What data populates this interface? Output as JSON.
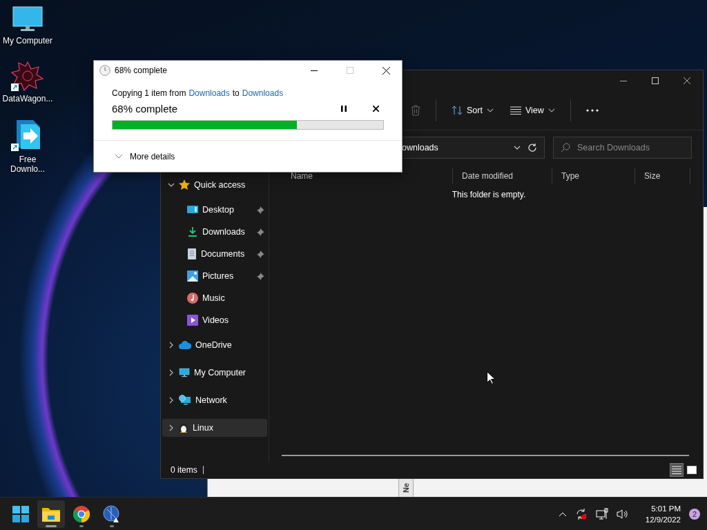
{
  "desktop_icons": [
    {
      "label": "My Computer"
    },
    {
      "label": "DataWagon..."
    },
    {
      "label": "Free Downlo..."
    }
  ],
  "background_window": {
    "tab_label": "Ne"
  },
  "explorer": {
    "toolbar": [
      {
        "label": "Sort"
      },
      {
        "label": "View"
      }
    ],
    "address": "ownloads",
    "search": {
      "placeholder": "Search Downloads"
    },
    "columns": [
      "Name",
      "Date modified",
      "Type",
      "Size"
    ],
    "empty_message": "This folder is empty.",
    "sidebar": [
      {
        "label": "Quick access",
        "expanded": true,
        "selected": false,
        "children": [
          {
            "label": "Desktop",
            "pinned": true,
            "selected": false
          },
          {
            "label": "Downloads",
            "pinned": true,
            "selected": false
          },
          {
            "label": "Documents",
            "pinned": true,
            "selected": false
          },
          {
            "label": "Pictures",
            "pinned": true,
            "selected": false
          },
          {
            "label": "Music",
            "pinned": false,
            "selected": false
          },
          {
            "label": "Videos",
            "pinned": false,
            "selected": false
          }
        ]
      },
      {
        "label": "OneDrive",
        "expanded": false,
        "selected": false
      },
      {
        "label": "My Computer",
        "expanded": false,
        "selected": false
      },
      {
        "label": "Network",
        "expanded": false,
        "selected": false
      },
      {
        "label": "Linux",
        "expanded": false,
        "selected": true
      }
    ],
    "status": "0 items",
    "view_buttons": [
      {
        "selected": true
      },
      {
        "selected": false
      }
    ]
  },
  "copy_dialog": {
    "title": "68% complete",
    "maximize_disabled": true,
    "message": {
      "prefix": "Copying 1 item from",
      "source": "Downloads",
      "middle": "to",
      "destination": "Downloads"
    },
    "progress_label": "68% complete",
    "level": 0.68,
    "more_details": "More details",
    "details_expanded": false
  },
  "taskbar": {
    "apps": [
      {
        "active": false,
        "running": false
      },
      {
        "active": true,
        "running": true
      },
      {
        "active": false,
        "running": true
      },
      {
        "active": false,
        "running": true
      }
    ],
    "clock": {
      "time": "5:01 PM",
      "date": "12/9/2022"
    },
    "notifications": "2"
  }
}
